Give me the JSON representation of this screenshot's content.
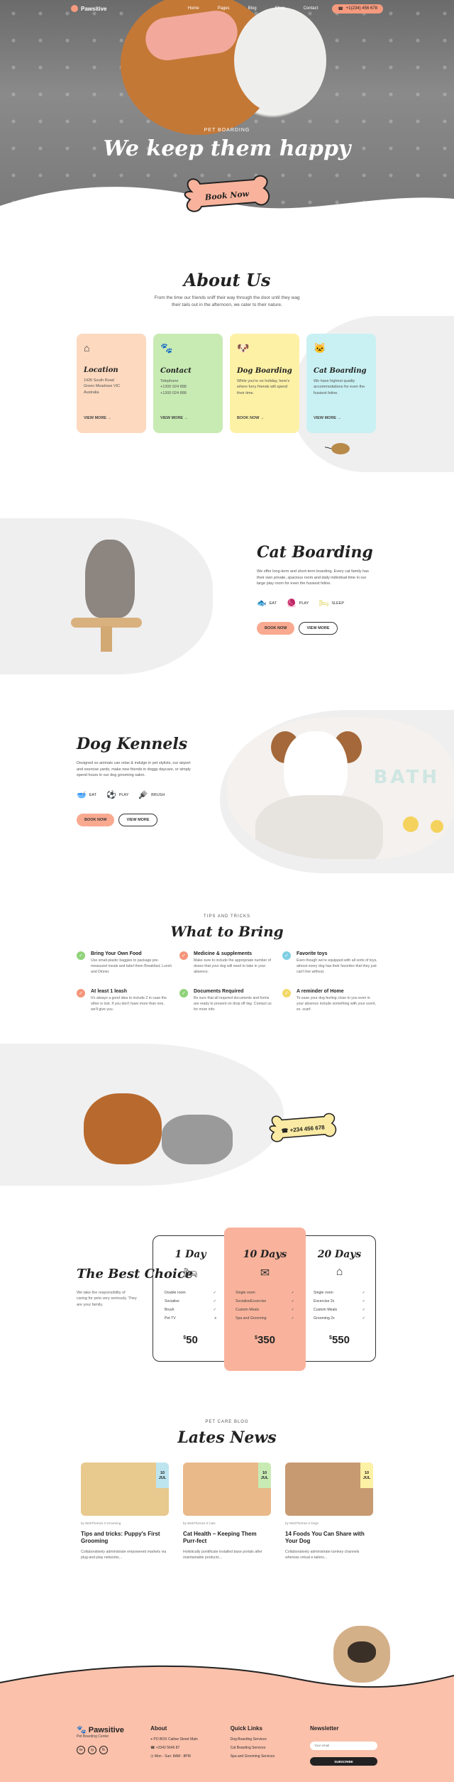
{
  "nav": {
    "brand": "Pawsitive",
    "items": [
      "Home",
      "Pages",
      "Blog",
      "Shop",
      "Contact"
    ],
    "phone": "+1(234) 456 678"
  },
  "hero": {
    "kicker": "PET BOARDING",
    "title": "We keep them happy",
    "cta": "Book Now"
  },
  "about": {
    "title": "About Us",
    "lead": "From the time our friends sniff their way through the door until they wag their tails out in the afternoon, we cater to their nature.",
    "cards": [
      {
        "title": "Location",
        "text": "1426 South Road\nGreen Meadows VIC\nAustralia",
        "link": "VIEW MORE"
      },
      {
        "title": "Contact",
        "text": "Telephone\n+1300 024 888\n+1300 024 888",
        "link": "VIEW MORE"
      },
      {
        "title": "Dog Boarding",
        "text": "While you're on holiday, here's where furry friends will spend their time.",
        "link": "BOOK NOW"
      },
      {
        "title": "Cat Boarding",
        "text": "We have highest quality accommodations for even the fussiest feline.",
        "link": "VIEW MORE"
      }
    ]
  },
  "cat": {
    "title": "Cat Boarding",
    "text": "We offer long-term and short-term boarding. Every cat family has their own private, spacious room and daily individual time in our large play room for even the fussiest feline.",
    "features": [
      "EAT",
      "PLAY",
      "SLEEP"
    ],
    "primary": "BOOK NOW",
    "secondary": "VIEW MORE"
  },
  "dog": {
    "title": "Dog Kennels",
    "text": "Designed so animals can relax & indulge in pet stylists, our airport and exercise yards, make new friends in doggy daycare, or simply spend hours in our dog grooming salon.",
    "features": [
      "EAT",
      "PLAY",
      "BRUSH"
    ],
    "primary": "BOOK NOW",
    "secondary": "VIEW MORE",
    "sign": "BATH"
  },
  "bring": {
    "kicker": "TIPS AND TRICKS",
    "title": "What to Bring",
    "tips": [
      {
        "title": "Bring Your Own Food",
        "text": "Use small plastic baggies to package pre-measured meals and label them Breakfast, Lunch and Dinner."
      },
      {
        "title": "Medicine & supplements",
        "text": "Make sure to include the appropriate number of doses that your dog will need to take in your absence."
      },
      {
        "title": "Favorite toys",
        "text": "Even though we're equipped with all sorts of toys, almost every dog has their favorites that they just can't live without."
      },
      {
        "title": "At least 1 leash",
        "text": "It's always a good idea to include 2 in case the other is lost. If you don't have more than one, we'll give you."
      },
      {
        "title": "Documents Required",
        "text": "Be sure that all required documents and forms are ready to present on drop off day. Contact us for more info."
      },
      {
        "title": "A reminder of Home",
        "text": "To ease your dog feeling close to you even in your absence include something with your scent, ex. scarf."
      }
    ]
  },
  "call": {
    "phone": "+234 456 678"
  },
  "pricing": {
    "title": "The Best Choice",
    "text": "We take the responsibility of caring for pets very seriously. They are your family.",
    "plans": [
      {
        "title": "1 Day",
        "items": [
          [
            "Double room",
            "✓"
          ],
          [
            "Socialise",
            "✓"
          ],
          [
            "Brush",
            "✓"
          ],
          [
            "Pet TV",
            "x"
          ]
        ],
        "currency": "$",
        "price": "50"
      },
      {
        "title": "10 Days",
        "items": [
          [
            "Single room",
            "✓"
          ],
          [
            "SocialiseExcercise",
            "✓"
          ],
          [
            "Custom Meals",
            "✓"
          ],
          [
            "Spa and Grooming",
            "✓"
          ]
        ],
        "currency": "$",
        "price": "350"
      },
      {
        "title": "20 Days",
        "items": [
          [
            "Single room",
            "✓"
          ],
          [
            "Excercise 2x",
            "✓"
          ],
          [
            "Custom Meals",
            "✓"
          ],
          [
            "Grooming 2x",
            "✓"
          ]
        ],
        "currency": "$",
        "price": "550"
      }
    ]
  },
  "news": {
    "kicker": "PET CARE BLOG",
    "title": "Lates News",
    "posts": [
      {
        "day": "10",
        "month": "JUL",
        "meta": "by WebThemes   0   Grooming",
        "title": "Tips and tricks: Puppy's First Grooming",
        "text": "Collaboratively administrate empowered markets via plug-and-play networks..."
      },
      {
        "day": "10",
        "month": "JUL",
        "meta": "by WebThemes   0   Cats",
        "title": "Cat Health – Keeping Them Purr-fect",
        "text": "Holistically pontificate installed base portals after maintainable products..."
      },
      {
        "day": "10",
        "month": "JUL",
        "meta": "by WebThemes   0   Dogs",
        "title": "14 Foods You Can Share with Your Dog",
        "text": "Collaboratively administrate turnkey channels whereas virtual e-tailers..."
      }
    ]
  },
  "footer": {
    "brand": "Pawsitive",
    "tagline": "Pet Boarding Center",
    "socials": [
      "tw",
      "ig",
      "fb"
    ],
    "about_title": "About",
    "about": [
      "PO BOX Callow Street Main",
      "+2342 5646 87",
      "Mon - Sun: 8AM - 8PM"
    ],
    "links_title": "Quick Links",
    "links": [
      "Dog Boarding Services",
      "Cat Boarding Services",
      "Spa and Grooming Services"
    ],
    "newsletter_title": "Newsletter",
    "newsletter_placeholder": "Your email",
    "subscribe": "SUBSCRIBE"
  }
}
